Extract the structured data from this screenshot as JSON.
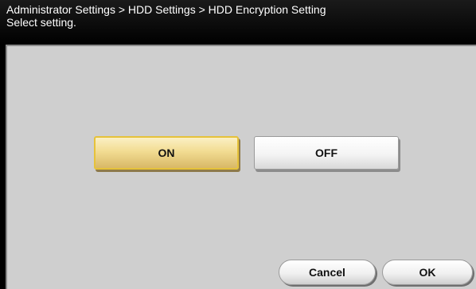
{
  "header": {
    "breadcrumb": "Administrator Settings > HDD Settings > HDD Encryption Setting",
    "instruction": "Select setting."
  },
  "options": {
    "on_label": "ON",
    "off_label": "OFF",
    "selected": "ON"
  },
  "footer": {
    "cancel_label": "Cancel",
    "ok_label": "OK"
  },
  "colors": {
    "header_bg": "#000000",
    "panel_bg": "#cfcfcf",
    "selected_border": "#e6c23a",
    "selected_fill": "#f2dc92"
  }
}
